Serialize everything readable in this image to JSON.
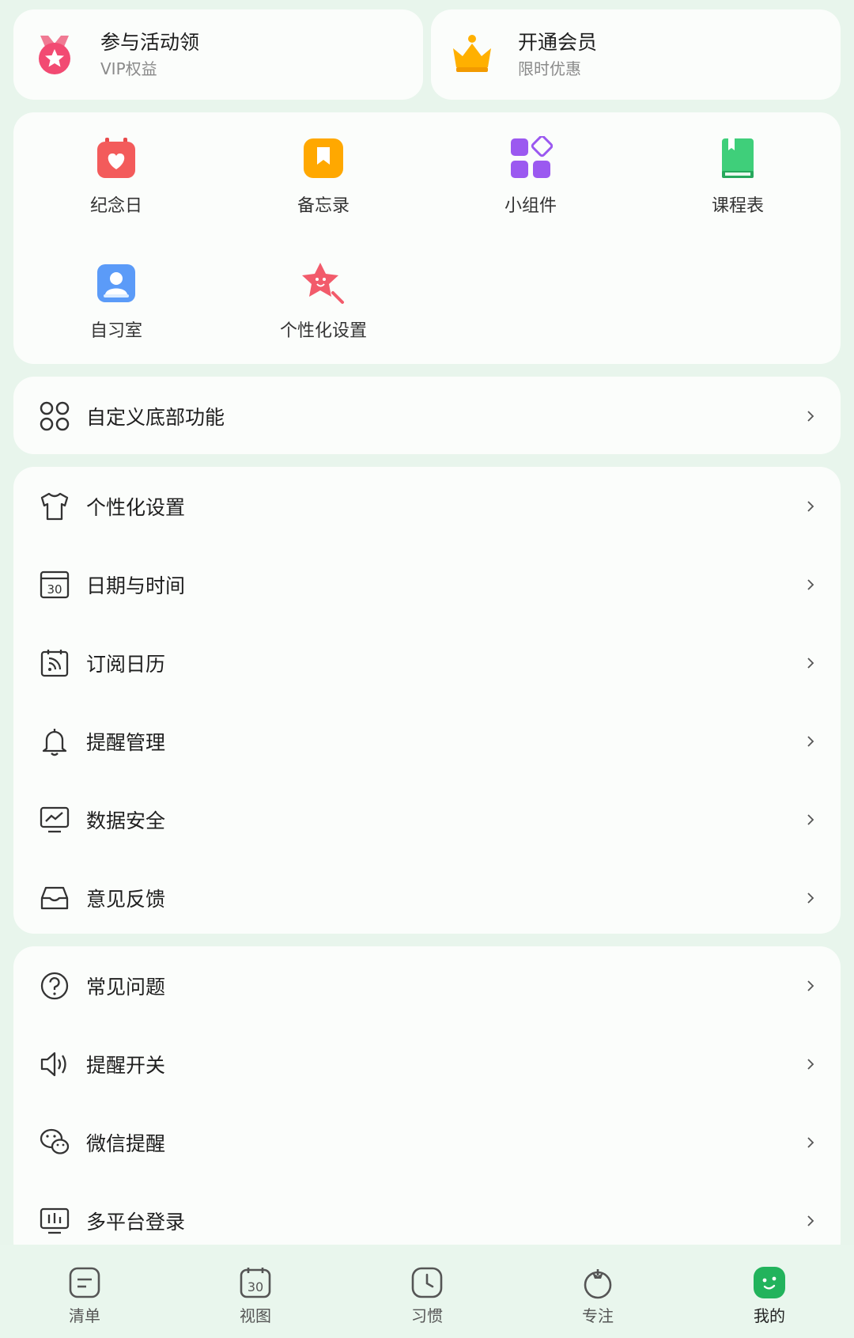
{
  "promos": [
    {
      "title": "参与活动领",
      "subtitle": "VIP权益",
      "icon": "medal-star-icon"
    },
    {
      "title": "开通会员",
      "subtitle": "限时优惠",
      "icon": "crown-icon"
    }
  ],
  "grid_items": [
    {
      "label": "纪念日",
      "icon": "heart-calendar-icon"
    },
    {
      "label": "备忘录",
      "icon": "bookmark-note-icon"
    },
    {
      "label": "小组件",
      "icon": "widgets-icon"
    },
    {
      "label": "课程表",
      "icon": "green-book-icon"
    },
    {
      "label": "自习室",
      "icon": "study-room-icon"
    },
    {
      "label": "个性化设置",
      "icon": "star-wand-icon"
    }
  ],
  "custom_bottom": {
    "label": "自定义底部功能",
    "icon": "grid-circles-icon"
  },
  "settings_list": [
    {
      "label": "个性化设置",
      "icon": "tshirt-icon"
    },
    {
      "label": "日期与时间",
      "icon": "calendar-30-icon"
    },
    {
      "label": "订阅日历",
      "icon": "calendar-rss-icon"
    },
    {
      "label": "提醒管理",
      "icon": "bell-icon"
    },
    {
      "label": "数据安全",
      "icon": "monitor-chart-icon"
    },
    {
      "label": "意见反馈",
      "icon": "inbox-icon"
    }
  ],
  "help_list": [
    {
      "label": "常见问题",
      "icon": "question-circle-icon"
    },
    {
      "label": "提醒开关",
      "icon": "speaker-icon"
    },
    {
      "label": "微信提醒",
      "icon": "wechat-icon"
    },
    {
      "label": "多平台登录",
      "icon": "monitor-bars-icon"
    }
  ],
  "bottom_nav": [
    {
      "label": "清单",
      "icon": "list-icon"
    },
    {
      "label": "视图",
      "icon": "calendar-view-icon"
    },
    {
      "label": "习惯",
      "icon": "clock-icon"
    },
    {
      "label": "专注",
      "icon": "tomato-icon"
    },
    {
      "label": "我的",
      "icon": "profile-face-icon",
      "active": true
    }
  ],
  "nav_calendar_day": "30",
  "colors": {
    "background": "#e8f5ec",
    "card": "#fbfdfb",
    "accent_green": "#22b35c",
    "vip_pink": "#f24a72",
    "crown_orange": "#ffb000"
  }
}
